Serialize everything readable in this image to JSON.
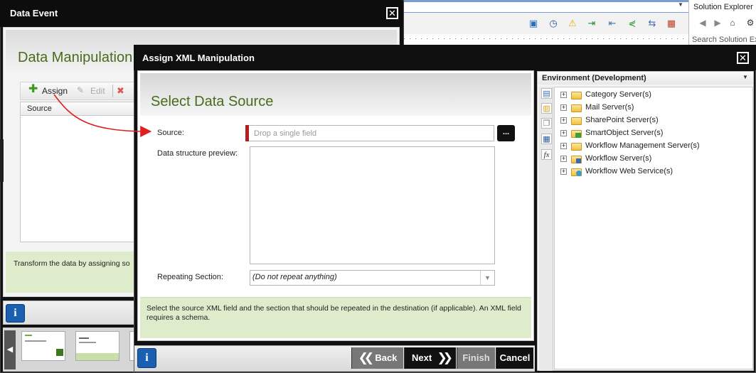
{
  "background": {
    "solution_explorer_title": "Solution Explorer",
    "solution_search_placeholder": "Search Solution Ex"
  },
  "data_event": {
    "title": "Data Event",
    "heading": "Data Manipulation",
    "toolbar": {
      "assign_label": "Assign",
      "edit_label": "Edit"
    },
    "grid": {
      "columns": [
        "Source"
      ]
    },
    "info_text": "Transform the data by assigning so"
  },
  "assign_xml": {
    "title": "Assign XML Manipulation",
    "heading": "Select Data Source",
    "fields": {
      "source_label": "Source:",
      "source_placeholder": "Drop a single field",
      "source_browse_label": "...",
      "preview_label": "Data structure preview:",
      "repeating_label": "Repeating Section:",
      "repeating_value": "(Do not repeat anything)"
    },
    "info_text": "Select the source XML field and the section that should be repeated in the destination (if applicable). An XML field requires a schema.",
    "buttons": {
      "back": "Back",
      "next": "Next",
      "finish": "Finish",
      "cancel": "Cancel"
    }
  },
  "environment": {
    "title": "Environment (Development)",
    "tree": [
      {
        "label": "Category Server(s)",
        "icon": "folder-icon"
      },
      {
        "label": "Mail Server(s)",
        "icon": "mail-folder-icon"
      },
      {
        "label": "SharePoint Server(s)",
        "icon": "sharepoint-folder-icon"
      },
      {
        "label": "SmartObject Server(s)",
        "icon": "smartobject-folder-icon"
      },
      {
        "label": "Workflow Management Server(s)",
        "icon": "workflow-mgmt-folder-icon"
      },
      {
        "label": "Workflow Server(s)",
        "icon": "workflow-server-folder-icon"
      },
      {
        "label": "Workflow Web Service(s)",
        "icon": "web-service-folder-icon"
      }
    ]
  },
  "colors": {
    "heading_green": "#4a6b1c",
    "info_band": "#dfeccc",
    "titlebar": "#0f0f0f",
    "required_marker": "#b02020",
    "info_button_blue": "#1b5fb0"
  }
}
